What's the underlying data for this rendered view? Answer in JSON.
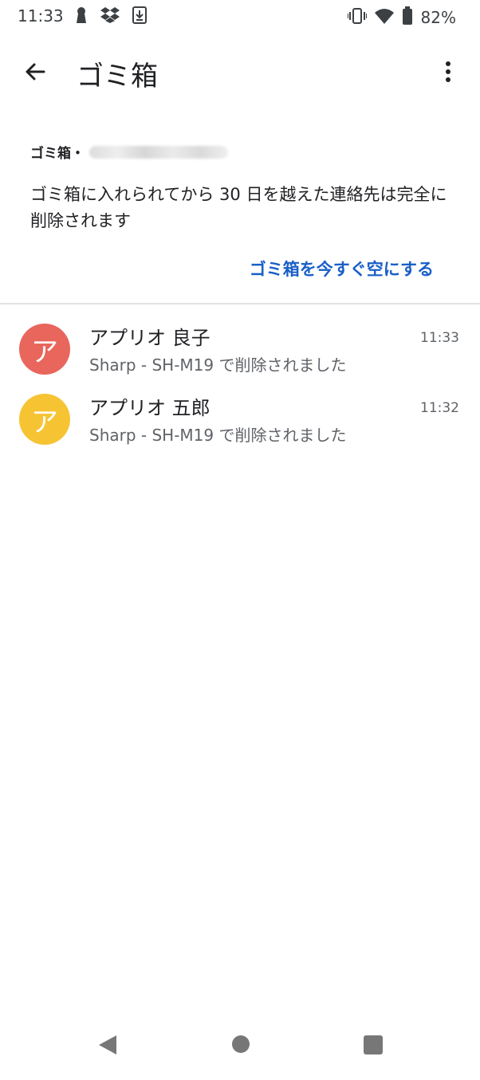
{
  "status_bar": {
    "time": "11:33",
    "battery_percent": "82%",
    "left_icons": [
      "keyhole-icon",
      "dropbox-icon",
      "download-icon"
    ],
    "right_icons": [
      "vibrate-icon",
      "wifi-icon",
      "battery-icon"
    ]
  },
  "app_bar": {
    "title": "ゴミ箱",
    "back_icon": "arrow-left-icon",
    "more_icon": "more-vertical-icon"
  },
  "trash_info": {
    "account_label": "ゴミ箱・",
    "description": "ゴミ箱に入れられてから 30 日を越えた連絡先は完全に削除されます",
    "empty_trash_label": "ゴミ箱を今すぐ空にする"
  },
  "contacts": [
    {
      "initial": "ア",
      "name": "アプリオ 良子",
      "subtitle": "Sharp - SH-M19 で削除されました",
      "time": "11:33",
      "avatar_color": "#e8665b"
    },
    {
      "initial": "ア",
      "name": "アプリオ 五郎",
      "subtitle": "Sharp - SH-M19 で削除されました",
      "time": "11:32",
      "avatar_color": "#f6c433"
    }
  ],
  "nav_bar": {
    "buttons": [
      "nav-back-icon",
      "nav-home-icon",
      "nav-recents-icon"
    ]
  },
  "colors": {
    "accent": "#1a5fc7",
    "divider": "#e3e3e3"
  }
}
